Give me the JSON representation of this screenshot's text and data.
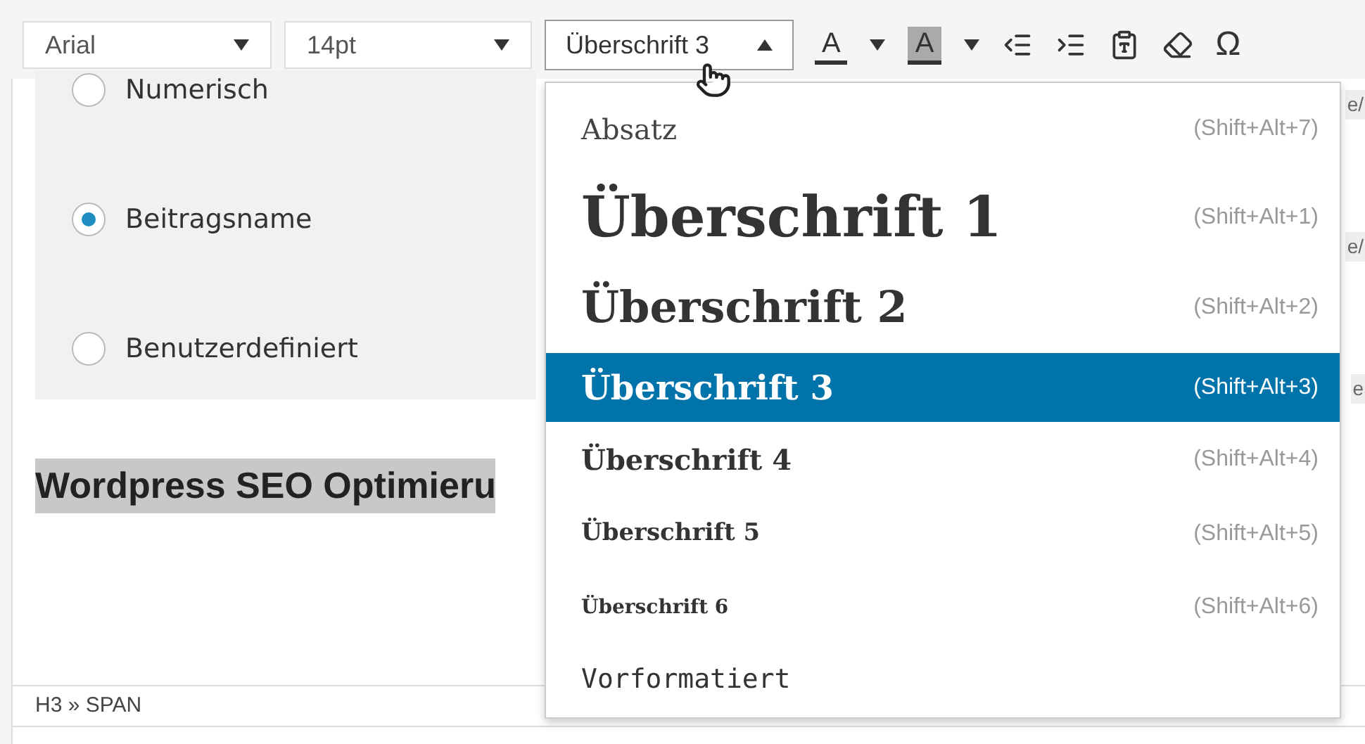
{
  "toolbar": {
    "font_family": "Arial",
    "font_size": "14pt",
    "format": {
      "value": "Überschrift 3",
      "expanded": true
    },
    "text_color_letter": "A",
    "background_color_letter": "A",
    "special_char": "Ω"
  },
  "options": [
    {
      "label": "Numerisch",
      "selected": false
    },
    {
      "label": "Beitragsname",
      "selected": true
    },
    {
      "label": "Benutzerdefiniert",
      "selected": false
    }
  ],
  "right_edge_fragments": [
    "e/",
    "e/",
    "e"
  ],
  "editor": {
    "heading": "Wordpress SEO Optimieru"
  },
  "status_bar": {
    "path": "H3 » SPAN"
  },
  "format_menu": [
    {
      "kind": "paragraph",
      "label": "Absatz",
      "shortcut": "(Shift+Alt+7)",
      "selected": false
    },
    {
      "kind": "h1",
      "label": "Überschrift 1",
      "shortcut": "(Shift+Alt+1)",
      "selected": false
    },
    {
      "kind": "h2",
      "label": "Überschrift 2",
      "shortcut": "(Shift+Alt+2)",
      "selected": false
    },
    {
      "kind": "h3",
      "label": "Überschrift 3",
      "shortcut": "(Shift+Alt+3)",
      "selected": true
    },
    {
      "kind": "h4",
      "label": "Überschrift 4",
      "shortcut": "(Shift+Alt+4)",
      "selected": false
    },
    {
      "kind": "h5",
      "label": "Überschrift 5",
      "shortcut": "(Shift+Alt+5)",
      "selected": false
    },
    {
      "kind": "h6",
      "label": "Überschrift 6",
      "shortcut": "(Shift+Alt+6)",
      "selected": false
    },
    {
      "kind": "pre",
      "label": "Vorformatiert",
      "selected": false
    }
  ]
}
